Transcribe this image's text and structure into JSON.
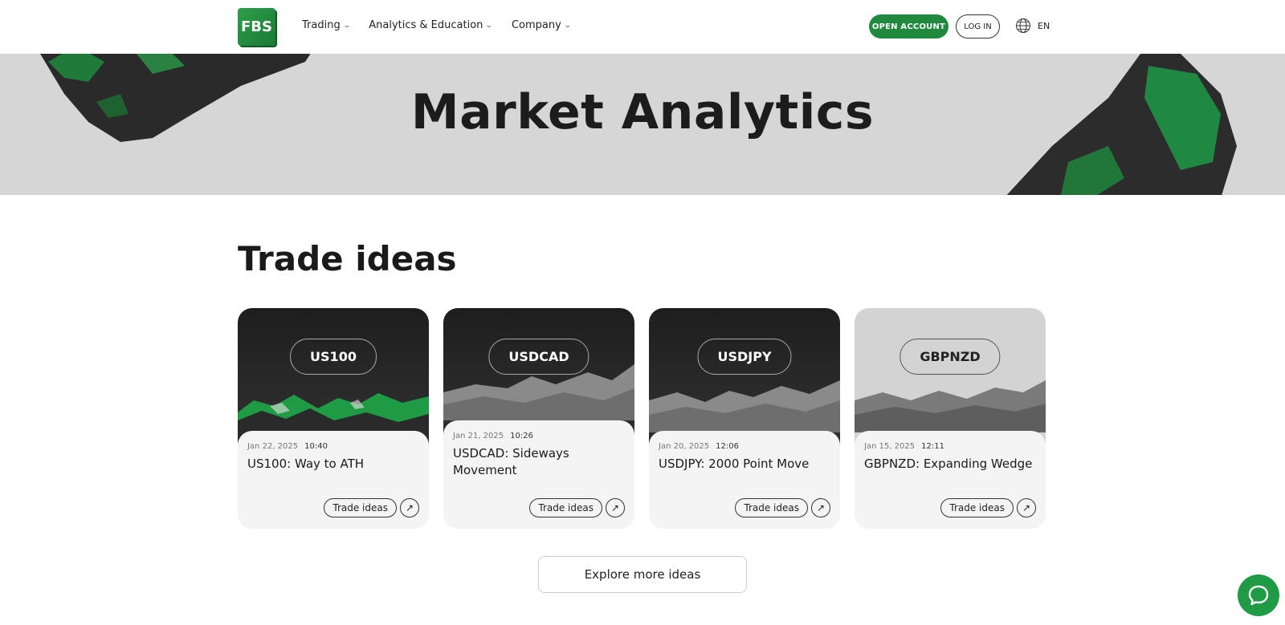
{
  "header": {
    "logo_text": "FBS",
    "nav": [
      {
        "label": "Trading"
      },
      {
        "label": "Analytics & Education"
      },
      {
        "label": "Company"
      }
    ],
    "open_account_label": "OPEN ACCOUNT",
    "login_label": "LOG IN",
    "language": "EN"
  },
  "hero": {
    "title": "Market Analytics"
  },
  "trade_ideas": {
    "title": "Trade ideas",
    "cards": [
      {
        "ticker": "US100",
        "date": "Jan 22, 2025",
        "time": "10:40",
        "title": "US100: Way to ATH",
        "tag": "Trade ideas",
        "theme": "dark-green"
      },
      {
        "ticker": "USDCAD",
        "date": "Jan 21, 2025",
        "time": "10:26",
        "title": "USDCAD: Sideways Movement",
        "tag": "Trade ideas",
        "theme": "dark"
      },
      {
        "ticker": "USDJPY",
        "date": "Jan 20, 2025",
        "time": "12:06",
        "title": "USDJPY: 2000 Point Move",
        "tag": "Trade ideas",
        "theme": "dark"
      },
      {
        "ticker": "GBPNZD",
        "date": "Jan 15, 2025",
        "time": "12:11",
        "title": "GBPNZD: Expanding Wedge",
        "tag": "Trade ideas",
        "theme": "light"
      }
    ],
    "explore_label": "Explore more ideas"
  },
  "colors": {
    "brand_green": "#1f8a3e",
    "hero_bg": "#d6d6d6",
    "card_bg": "#f4f4f4"
  },
  "icons": {
    "nav_chevron": "chevron-down-icon",
    "language": "globe-icon",
    "card_arrow": "arrow-up-right-icon",
    "chat": "chat-bubble-icon"
  }
}
